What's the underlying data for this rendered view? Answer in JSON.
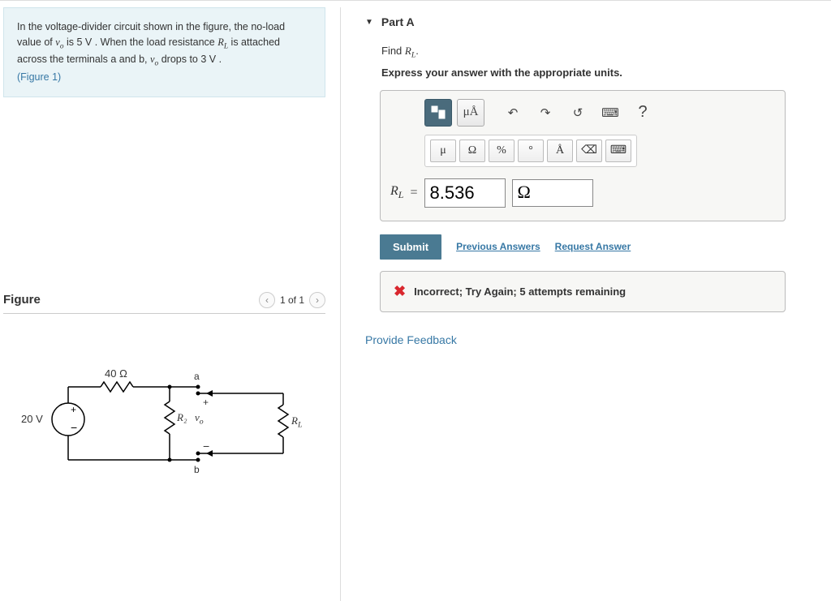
{
  "problem": {
    "text_prefix": "In the voltage-divider circuit shown in the figure, the no-load value of ",
    "vo": "v",
    "vo_sub": "o",
    "is_text": " is ",
    "noload_value": "5 V",
    "when_text": " . When the load resistance ",
    "RL": "R",
    "RL_sub": "L",
    "attach_text": " is attached across the terminals a and b, ",
    "drops_text": " drops to ",
    "loaded_value": "3 V",
    "period": " .",
    "figure_link": "(Figure 1)"
  },
  "figure": {
    "title": "Figure",
    "nav_text": "1 of 1"
  },
  "circuit": {
    "source": "20 V",
    "r1": "40 Ω",
    "r2": "R₂",
    "vo": "v",
    "vo_sub": "o",
    "rl": "R",
    "rl_sub": "L",
    "node_a": "a",
    "node_b": "b",
    "plus": "+",
    "minus": "−"
  },
  "part": {
    "label": "Part A",
    "find_prefix": "Find ",
    "find_var": "R",
    "find_sub": "L",
    "find_suffix": ".",
    "instruction": "Express your answer with the appropriate units."
  },
  "toolbar": {
    "muA": "μÅ",
    "undo": "↶",
    "redo": "↷",
    "reset": "↺",
    "keyboard": "⌨",
    "help": "?",
    "mu": "μ",
    "omega": "Ω",
    "percent": "%",
    "degree": "°",
    "angstrom": "Å",
    "backspace": "⌫",
    "kb2": "⌨"
  },
  "answer": {
    "var": "R",
    "var_sub": "L",
    "equals": " = ",
    "value": "8.536",
    "unit": "Ω"
  },
  "actions": {
    "submit": "Submit",
    "previous": "Previous Answers",
    "request": "Request Answer"
  },
  "feedback": {
    "message": "Incorrect; Try Again; 5 attempts remaining"
  },
  "footer": {
    "provide": "Provide Feedback"
  }
}
